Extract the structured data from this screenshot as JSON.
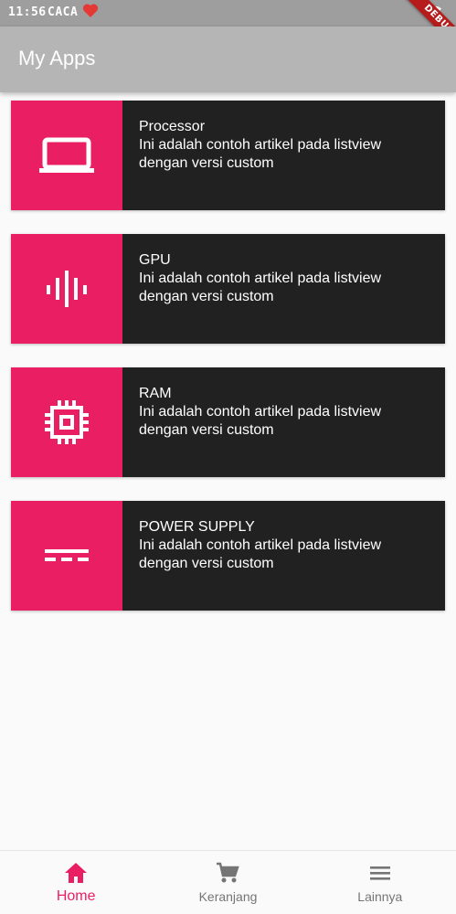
{
  "status_bar": {
    "time": "11:56",
    "carrier": "CACA",
    "debug_label": "DEBUG"
  },
  "app_bar": {
    "title": "My Apps"
  },
  "colors": {
    "accent": "#e91e63",
    "card_bg": "#212121",
    "app_bar_bg": "#b5b5b5",
    "inactive": "#757575"
  },
  "items": [
    {
      "title": "Processor",
      "line1": "Ini adalah contoh artikel pada listview",
      "line2": "dengan versi custom",
      "icon": "laptop-icon"
    },
    {
      "title": "GPU",
      "line1": "Ini adalah contoh artikel pada listview",
      "line2": "dengan versi custom",
      "icon": "graphic-eq-icon"
    },
    {
      "title": "RAM",
      "line1": "Ini adalah contoh artikel pada listview",
      "line2": "dengan versi custom",
      "icon": "memory-chip-icon"
    },
    {
      "title": "POWER SUPPLY",
      "line1": "Ini adalah contoh artikel pada listview",
      "line2": "dengan versi custom",
      "icon": "power-input-icon"
    }
  ],
  "bottom_nav": [
    {
      "label": "Home",
      "icon": "home-icon",
      "active": true
    },
    {
      "label": "Keranjang",
      "icon": "shopping-cart-icon",
      "active": false
    },
    {
      "label": "Lainnya",
      "icon": "menu-icon",
      "active": false
    }
  ]
}
